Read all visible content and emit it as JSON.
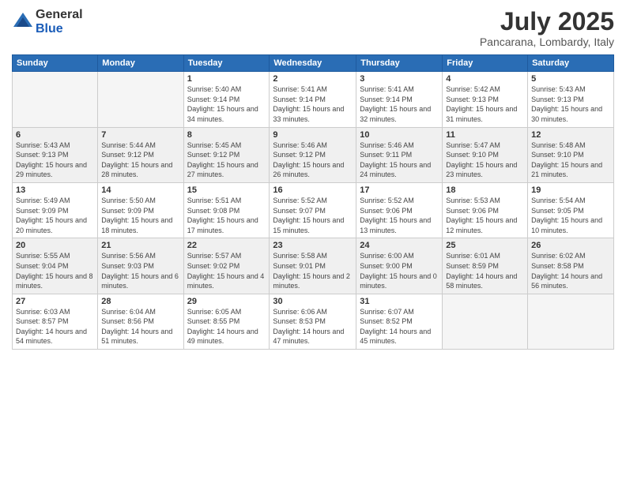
{
  "logo": {
    "general": "General",
    "blue": "Blue"
  },
  "title": "July 2025",
  "subtitle": "Pancarana, Lombardy, Italy",
  "weekdays": [
    "Sunday",
    "Monday",
    "Tuesday",
    "Wednesday",
    "Thursday",
    "Friday",
    "Saturday"
  ],
  "weeks": [
    [
      {
        "day": "",
        "info": ""
      },
      {
        "day": "",
        "info": ""
      },
      {
        "day": "1",
        "info": "Sunrise: 5:40 AM\nSunset: 9:14 PM\nDaylight: 15 hours and 34 minutes."
      },
      {
        "day": "2",
        "info": "Sunrise: 5:41 AM\nSunset: 9:14 PM\nDaylight: 15 hours and 33 minutes."
      },
      {
        "day": "3",
        "info": "Sunrise: 5:41 AM\nSunset: 9:14 PM\nDaylight: 15 hours and 32 minutes."
      },
      {
        "day": "4",
        "info": "Sunrise: 5:42 AM\nSunset: 9:13 PM\nDaylight: 15 hours and 31 minutes."
      },
      {
        "day": "5",
        "info": "Sunrise: 5:43 AM\nSunset: 9:13 PM\nDaylight: 15 hours and 30 minutes."
      }
    ],
    [
      {
        "day": "6",
        "info": "Sunrise: 5:43 AM\nSunset: 9:13 PM\nDaylight: 15 hours and 29 minutes."
      },
      {
        "day": "7",
        "info": "Sunrise: 5:44 AM\nSunset: 9:12 PM\nDaylight: 15 hours and 28 minutes."
      },
      {
        "day": "8",
        "info": "Sunrise: 5:45 AM\nSunset: 9:12 PM\nDaylight: 15 hours and 27 minutes."
      },
      {
        "day": "9",
        "info": "Sunrise: 5:46 AM\nSunset: 9:12 PM\nDaylight: 15 hours and 26 minutes."
      },
      {
        "day": "10",
        "info": "Sunrise: 5:46 AM\nSunset: 9:11 PM\nDaylight: 15 hours and 24 minutes."
      },
      {
        "day": "11",
        "info": "Sunrise: 5:47 AM\nSunset: 9:10 PM\nDaylight: 15 hours and 23 minutes."
      },
      {
        "day": "12",
        "info": "Sunrise: 5:48 AM\nSunset: 9:10 PM\nDaylight: 15 hours and 21 minutes."
      }
    ],
    [
      {
        "day": "13",
        "info": "Sunrise: 5:49 AM\nSunset: 9:09 PM\nDaylight: 15 hours and 20 minutes."
      },
      {
        "day": "14",
        "info": "Sunrise: 5:50 AM\nSunset: 9:09 PM\nDaylight: 15 hours and 18 minutes."
      },
      {
        "day": "15",
        "info": "Sunrise: 5:51 AM\nSunset: 9:08 PM\nDaylight: 15 hours and 17 minutes."
      },
      {
        "day": "16",
        "info": "Sunrise: 5:52 AM\nSunset: 9:07 PM\nDaylight: 15 hours and 15 minutes."
      },
      {
        "day": "17",
        "info": "Sunrise: 5:52 AM\nSunset: 9:06 PM\nDaylight: 15 hours and 13 minutes."
      },
      {
        "day": "18",
        "info": "Sunrise: 5:53 AM\nSunset: 9:06 PM\nDaylight: 15 hours and 12 minutes."
      },
      {
        "day": "19",
        "info": "Sunrise: 5:54 AM\nSunset: 9:05 PM\nDaylight: 15 hours and 10 minutes."
      }
    ],
    [
      {
        "day": "20",
        "info": "Sunrise: 5:55 AM\nSunset: 9:04 PM\nDaylight: 15 hours and 8 minutes."
      },
      {
        "day": "21",
        "info": "Sunrise: 5:56 AM\nSunset: 9:03 PM\nDaylight: 15 hours and 6 minutes."
      },
      {
        "day": "22",
        "info": "Sunrise: 5:57 AM\nSunset: 9:02 PM\nDaylight: 15 hours and 4 minutes."
      },
      {
        "day": "23",
        "info": "Sunrise: 5:58 AM\nSunset: 9:01 PM\nDaylight: 15 hours and 2 minutes."
      },
      {
        "day": "24",
        "info": "Sunrise: 6:00 AM\nSunset: 9:00 PM\nDaylight: 15 hours and 0 minutes."
      },
      {
        "day": "25",
        "info": "Sunrise: 6:01 AM\nSunset: 8:59 PM\nDaylight: 14 hours and 58 minutes."
      },
      {
        "day": "26",
        "info": "Sunrise: 6:02 AM\nSunset: 8:58 PM\nDaylight: 14 hours and 56 minutes."
      }
    ],
    [
      {
        "day": "27",
        "info": "Sunrise: 6:03 AM\nSunset: 8:57 PM\nDaylight: 14 hours and 54 minutes."
      },
      {
        "day": "28",
        "info": "Sunrise: 6:04 AM\nSunset: 8:56 PM\nDaylight: 14 hours and 51 minutes."
      },
      {
        "day": "29",
        "info": "Sunrise: 6:05 AM\nSunset: 8:55 PM\nDaylight: 14 hours and 49 minutes."
      },
      {
        "day": "30",
        "info": "Sunrise: 6:06 AM\nSunset: 8:53 PM\nDaylight: 14 hours and 47 minutes."
      },
      {
        "day": "31",
        "info": "Sunrise: 6:07 AM\nSunset: 8:52 PM\nDaylight: 14 hours and 45 minutes."
      },
      {
        "day": "",
        "info": ""
      },
      {
        "day": "",
        "info": ""
      }
    ]
  ]
}
